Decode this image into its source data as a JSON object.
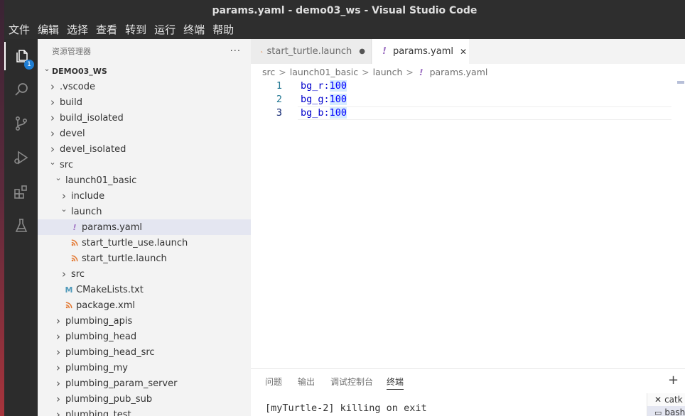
{
  "window_title": "params.yaml - demo03_ws - Visual Studio Code",
  "menu": [
    "文件",
    "编辑",
    "选择",
    "查看",
    "转到",
    "运行",
    "终端",
    "帮助"
  ],
  "activity_bar": {
    "explorer_badge": "1"
  },
  "sidebar": {
    "title": "资源管理器",
    "more": "···",
    "tree": [
      {
        "label": "DEMO03_WS",
        "type": "root",
        "expanded": true
      },
      {
        "label": ".vscode",
        "type": "folder",
        "expanded": false
      },
      {
        "label": "build",
        "type": "folder",
        "expanded": false
      },
      {
        "label": "build_isolated",
        "type": "folder",
        "expanded": false
      },
      {
        "label": "devel",
        "type": "folder",
        "expanded": false
      },
      {
        "label": "devel_isolated",
        "type": "folder",
        "expanded": false
      },
      {
        "label": "src",
        "type": "folder",
        "expanded": true
      },
      {
        "label": "launch01_basic",
        "type": "folder",
        "expanded": true
      },
      {
        "label": "include",
        "type": "folder",
        "expanded": false
      },
      {
        "label": "launch",
        "type": "folder",
        "expanded": true
      },
      {
        "label": "params.yaml",
        "type": "yaml",
        "selected": true
      },
      {
        "label": "start_turtle_use.launch",
        "type": "launch"
      },
      {
        "label": "start_turtle.launch",
        "type": "launch"
      },
      {
        "label": "src",
        "type": "folder",
        "expanded": false
      },
      {
        "label": "CMakeLists.txt",
        "type": "cmake"
      },
      {
        "label": "package.xml",
        "type": "xml"
      },
      {
        "label": "plumbing_apis",
        "type": "folder",
        "expanded": false
      },
      {
        "label": "plumbing_head",
        "type": "folder",
        "expanded": false
      },
      {
        "label": "plumbing_head_src",
        "type": "folder",
        "expanded": false
      },
      {
        "label": "plumbing_my",
        "type": "folder",
        "expanded": false
      },
      {
        "label": "plumbing_param_server",
        "type": "folder",
        "expanded": false
      },
      {
        "label": "plumbing_pub_sub",
        "type": "folder",
        "expanded": false
      },
      {
        "label": "plumbing_test",
        "type": "folder",
        "expanded": false
      }
    ]
  },
  "tabs": [
    {
      "label": "start_turtle.launch",
      "icon": "rss-icon",
      "dirty_marker": "●"
    },
    {
      "label": "params.yaml",
      "icon": "!",
      "close": "✕"
    }
  ],
  "breadcrumb": [
    "src",
    "launch01_basic",
    "launch",
    "params.yaml"
  ],
  "breadcrumb_sep": ">",
  "editor": {
    "lines": [
      {
        "num": "1",
        "key": "bg_r:",
        "value": "100"
      },
      {
        "num": "2",
        "key": "bg_g:",
        "value": "100"
      },
      {
        "num": "3",
        "key": "bg_b:",
        "value": "100"
      }
    ]
  },
  "panel": {
    "tabs": [
      "问题",
      "输出",
      "调试控制台",
      "终端"
    ],
    "active_tab": "终端",
    "terminal_output": "[myTurtle-2] killing on exit",
    "terminal_list": [
      "catk",
      "bash"
    ],
    "add_button": "+"
  },
  "colors": {
    "activity_bar": "#2c2c2c",
    "titlebar": "#2e2e2e",
    "accent_badge": "#1f7ed4",
    "yaml_icon": "#a074c4",
    "launch_icon": "#e37933",
    "cmake_icon": "#519aba"
  }
}
